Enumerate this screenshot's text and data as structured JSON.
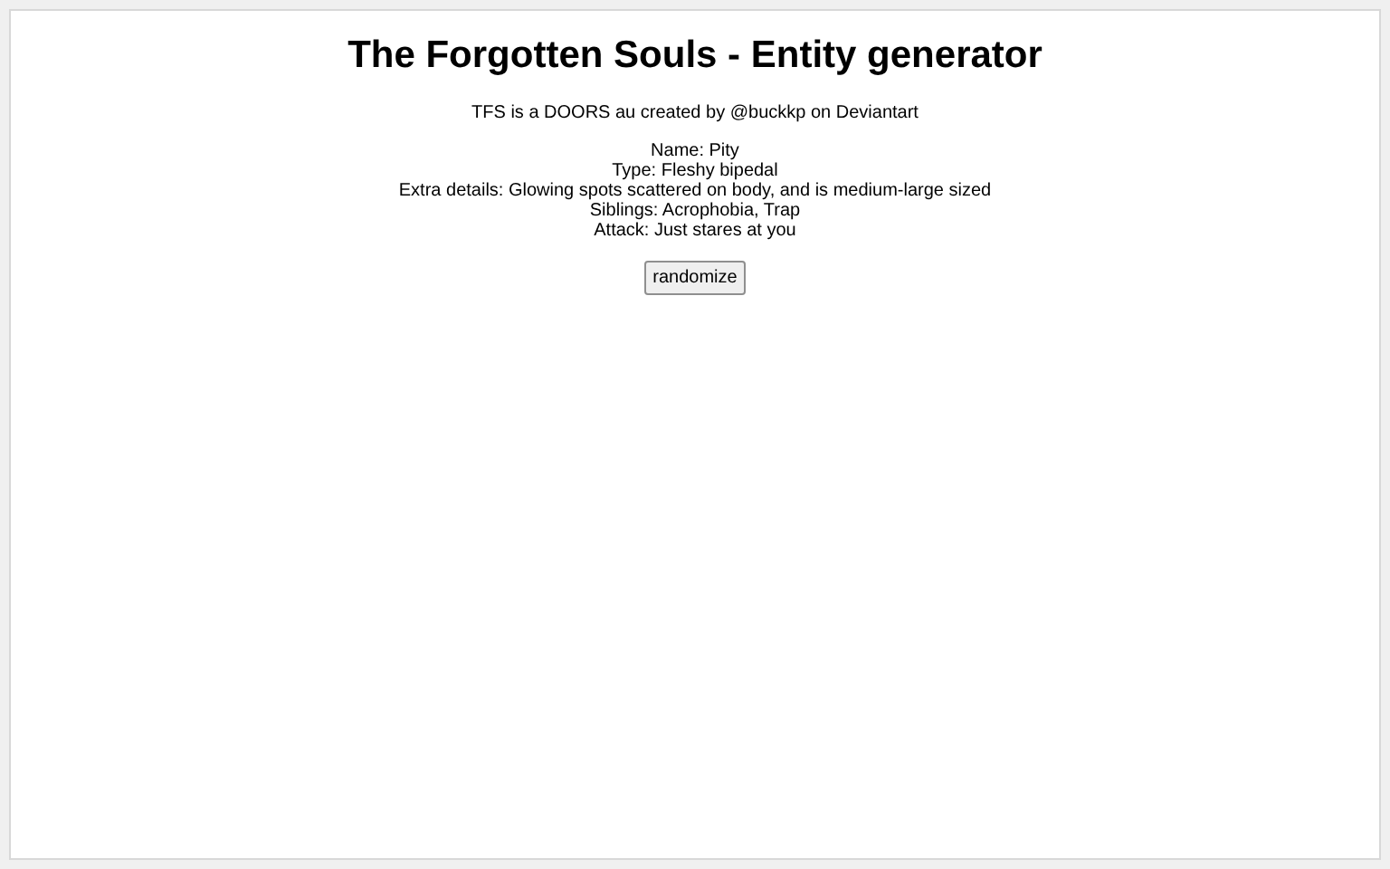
{
  "title": "The Forgotten Souls - Entity generator",
  "credit": "TFS is a DOORS au created by @buckkp on Deviantart",
  "details": [
    "Name: Pity",
    "Type: Fleshy bipedal",
    "Extra details: Glowing spots scattered on body, and is medium-large sized",
    "Siblings: Acrophobia, Trap",
    "Attack: Just stares at you"
  ],
  "button": "randomize"
}
